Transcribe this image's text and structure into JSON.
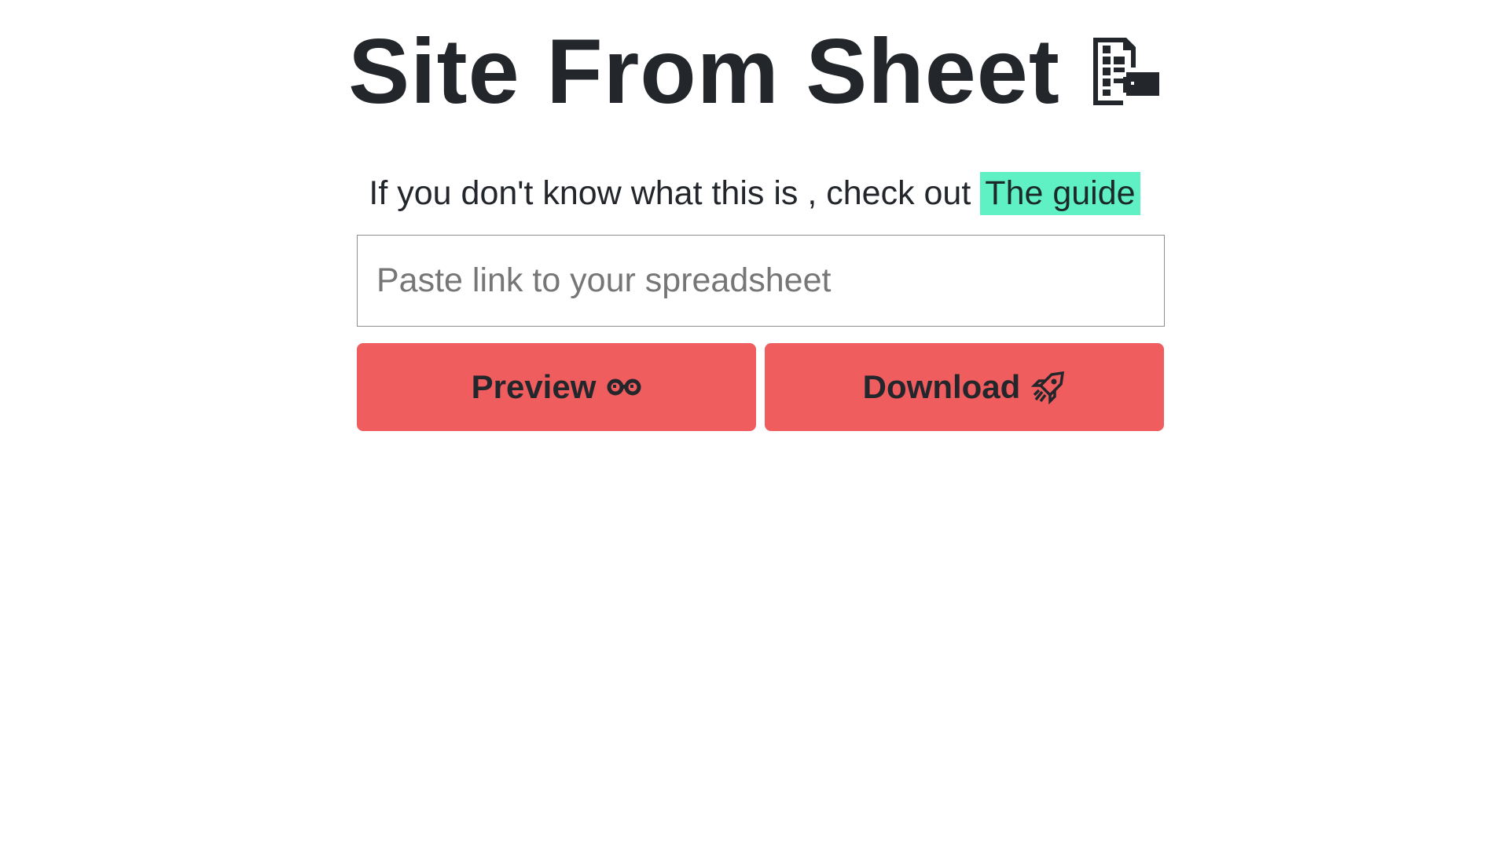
{
  "header": {
    "title": "Site From Sheet",
    "title_icon": "spreadsheet-icon"
  },
  "intro": {
    "text": "If you don't know what this is , check out",
    "guide_link": "The guide",
    "guide_highlight_color": "#5ff0c4"
  },
  "form": {
    "url_input": {
      "value": "",
      "placeholder": "Paste link to your spreadsheet"
    },
    "preview_button": {
      "label": "Preview",
      "icon": "glasses-icon"
    },
    "download_button": {
      "label": "Download",
      "icon": "rocket-icon"
    },
    "button_color": "#f05d5e"
  }
}
